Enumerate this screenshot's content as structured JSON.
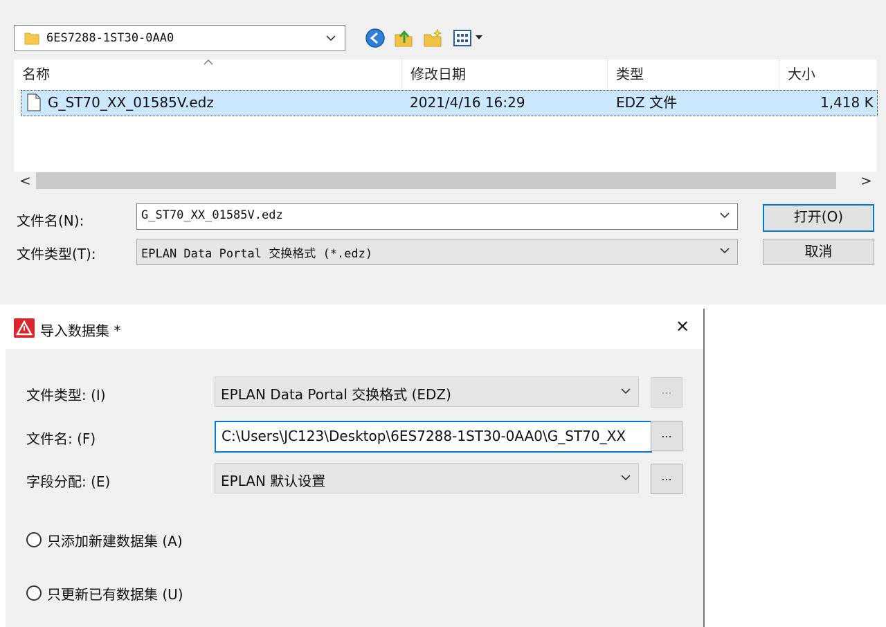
{
  "open_dialog": {
    "folder": "6ES7288-1ST30-0AA0",
    "toolbar": {
      "back_icon": "back-arrow-icon",
      "up_icon": "up-folder-icon",
      "new_folder_icon": "new-folder-icon",
      "view_icon": "view-menu-icon"
    },
    "columns": [
      "名称",
      "修改日期",
      "类型",
      "大小"
    ],
    "files": [
      {
        "name": "G_ST70_XX_01585V.edz",
        "modified": "2021/4/16 16:29",
        "type": "EDZ 文件",
        "size": "1,418 K"
      }
    ],
    "scroll_left": "<",
    "scroll_right": ">",
    "filename_label": "文件名(N):",
    "filename_value": "G_ST70_XX_01585V.edz",
    "filetype_label": "文件类型(T):",
    "filetype_value": "EPLAN Data Portal 交换格式 (*.edz)",
    "open_button": "打开(O)",
    "cancel_button": "取消"
  },
  "import_dialog": {
    "title": "导入数据集 *",
    "close_symbol": "✕",
    "file_type_label": "文件类型: (I)",
    "file_type_value": "EPLAN Data Portal 交换格式 (EDZ)",
    "file_name_label": "文件名: (F)",
    "file_name_value": "C:\\Users\\JC123\\Desktop\\6ES7288-1ST30-0AA0\\G_ST70_XX",
    "field_assign_label": "字段分配: (E)",
    "field_assign_value": "EPLAN 默认设置",
    "browse_dots": "...",
    "radio_add_new": "只添加新建数据集 (A)",
    "radio_update_existing": "只更新已有数据集 (U)"
  },
  "colors": {
    "selection": "#cce8ff",
    "focus_border": "#0078d7",
    "dialog_bg": "#f0f0f0",
    "eplan_red": "#d9262c"
  }
}
